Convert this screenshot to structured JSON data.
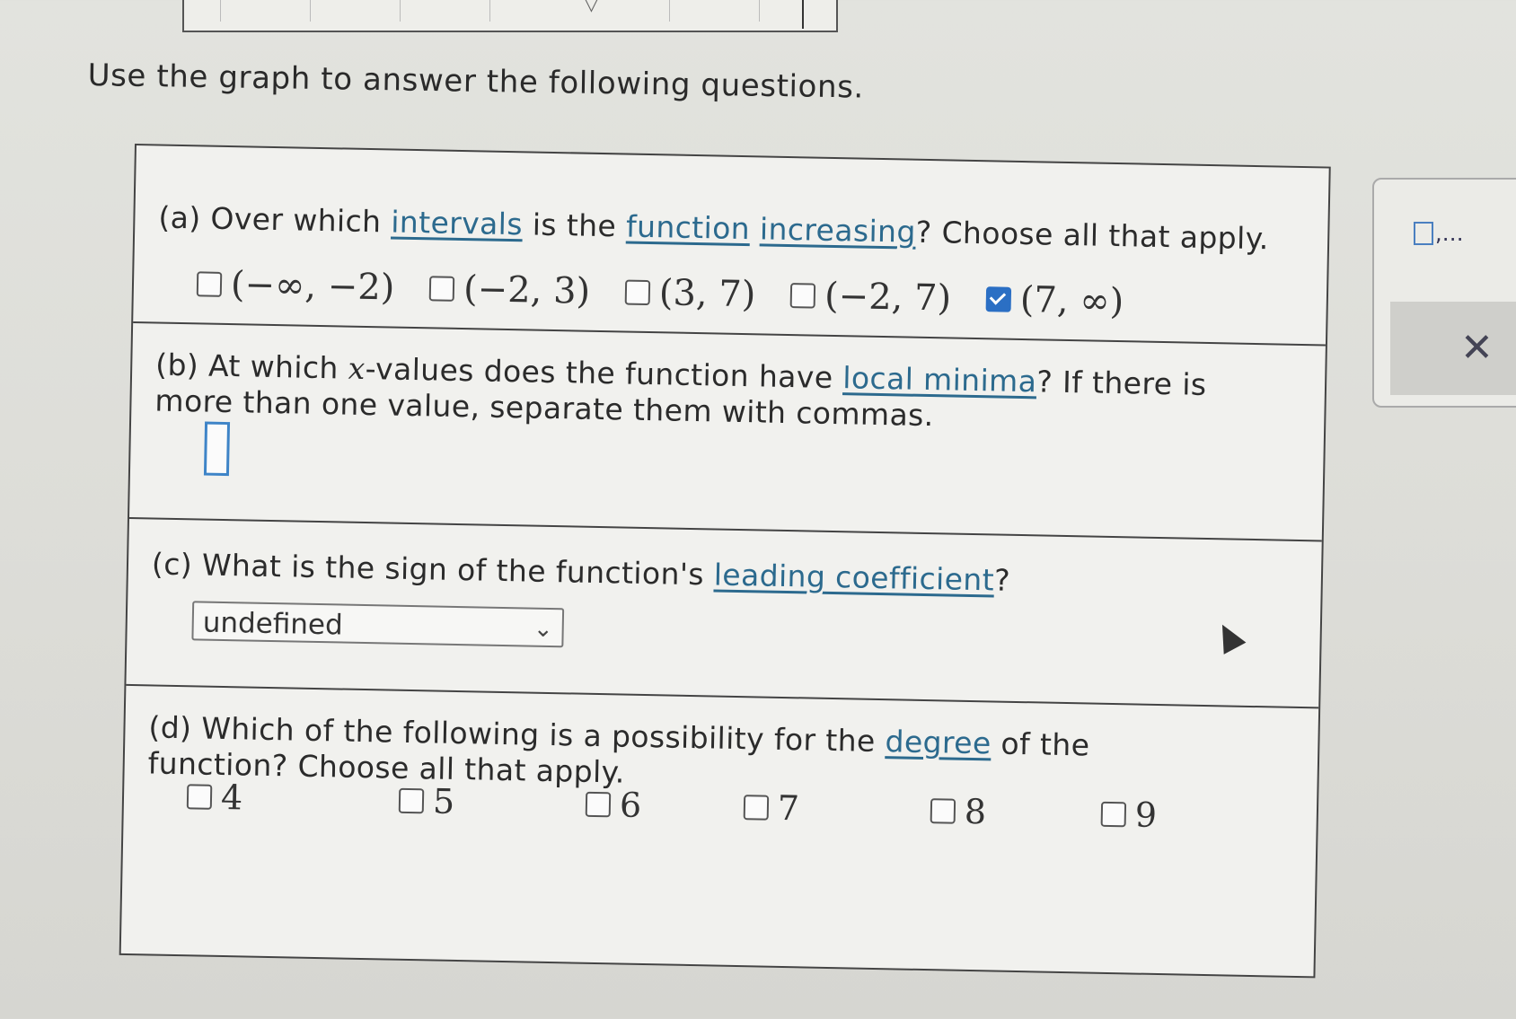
{
  "instructions": "Use the graph to answer the following questions.",
  "part_a": {
    "label": "(a)",
    "text_before": "Over which",
    "link1": "intervals",
    "text_mid1": "is the",
    "link2": "function",
    "link3": "increasing",
    "text_after": "? Choose all that apply.",
    "options": [
      {
        "label": "(−∞, −2)",
        "checked": false
      },
      {
        "label": "(−2, 3)",
        "checked": false
      },
      {
        "label": "(3, 7)",
        "checked": false
      },
      {
        "label": "(−2, 7)",
        "checked": false
      },
      {
        "label": "(7, ∞)",
        "checked": true
      }
    ]
  },
  "part_b": {
    "label": "(b)",
    "text_before": "At which",
    "math_var": "x",
    "text_mid": "-values does the function have",
    "link": "local minima",
    "text_after": "? If there is more than one value, separate them with commas.",
    "answer_value": ""
  },
  "part_c": {
    "label": "(c)",
    "text_before": "What is the sign of the function's",
    "link": "leading coefficient",
    "text_after": "?",
    "select_value": "undefined"
  },
  "part_d": {
    "label": "(d)",
    "text_before": "Which of the following is a possibility for the",
    "link": "degree",
    "text_after": "of the function? Choose all that apply.",
    "options": [
      {
        "label": "4",
        "checked": false
      },
      {
        "label": "5",
        "checked": false
      },
      {
        "label": "6",
        "checked": false
      },
      {
        "label": "7",
        "checked": false
      },
      {
        "label": "8",
        "checked": false
      },
      {
        "label": "9",
        "checked": false
      }
    ]
  },
  "side_panel": {
    "template_label": ",…",
    "clear_icon": "close-icon"
  },
  "colors": {
    "link": "#2c6a8e",
    "checkbox_checked": "#2b6fc4",
    "answer_box_border": "#3e84c7"
  }
}
